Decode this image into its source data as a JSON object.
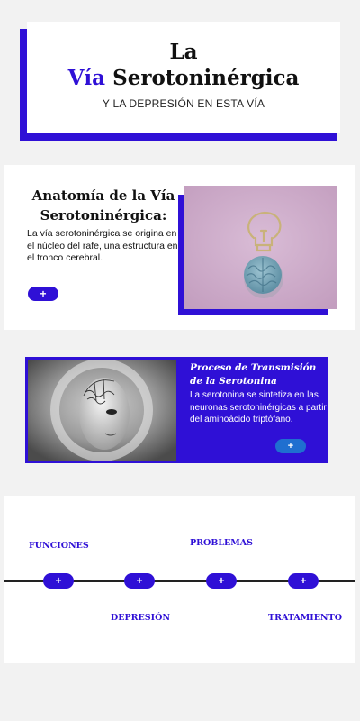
{
  "title": {
    "line1": "La",
    "line2_highlight": "Vía",
    "line2_rest": "Serotoninérgica",
    "subtitle": "Y LA DEPRESIÓN EN ESTA VÍA"
  },
  "anatomy": {
    "title": "Anatomía de la Vía Serotoninérgica:",
    "text": "La vía serotoninérgica se origina en el núcleo del rafe, una estructura en el tronco cerebral.",
    "button_label": "+",
    "image_icon": "lightbulb-and-brain-photo"
  },
  "process": {
    "title": "Proceso de Transmisión de la Serotonina",
    "text": "La serotonina se sintetiza en las neuronas serotoninérgicas a partir del aminoácido triptófano.",
    "button_label": "+",
    "image_icon": "mannequin-head-brain-photo"
  },
  "timeline": {
    "items": [
      {
        "label": "FUNCIONES",
        "button": "+"
      },
      {
        "label": "DEPRESIÓN",
        "button": "+"
      },
      {
        "label": "PROBLEMAS",
        "button": "+"
      },
      {
        "label": "TRATAMIENTO",
        "button": "+"
      }
    ]
  },
  "colors": {
    "accent": "#2f10d6",
    "background": "#f2f2f2",
    "card": "#ffffff"
  }
}
